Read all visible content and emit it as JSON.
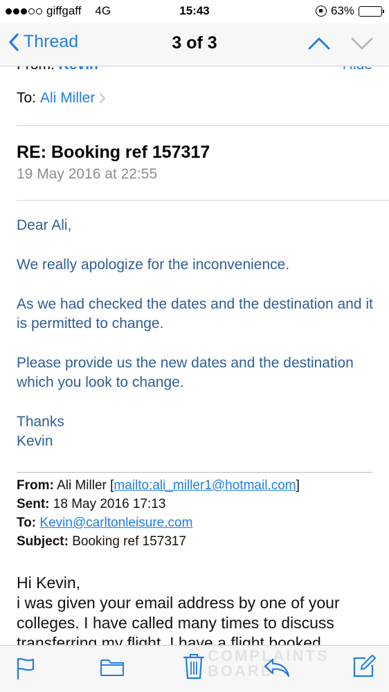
{
  "status_bar": {
    "carrier": "giffgaff",
    "network": "4G",
    "time": "15:43",
    "battery_percent": "63%",
    "battery_level": 0.63
  },
  "nav": {
    "back_label": "Thread",
    "title": "3 of 3"
  },
  "header": {
    "from_label": "From:",
    "from_name": "Kevin",
    "hide_label": "Hide",
    "to_label": "To:",
    "to_name": "Ali Miller",
    "subject": "RE: Booking ref 157317",
    "date": "19 May 2016 at 22:55"
  },
  "body": {
    "paragraphs": [
      "Dear Ali,",
      "We really apologize for the inconvenience.",
      "As we had checked the dates and the destination and it is permitted to change.",
      "Please provide us the new dates and the destination which you look to change.",
      "Thanks",
      "Kevin"
    ]
  },
  "quoted": {
    "from_label": "From:",
    "from_name": "Ali Miller",
    "from_link": "mailto:ali_miller1@hotmail.com",
    "sent_label": "Sent:",
    "sent_value": "18 May 2016 17:13",
    "to_label": "To:",
    "to_value": "Kevin@carltonleisure.com",
    "subject_label": "Subject:",
    "subject_value": "Booking ref 157317",
    "greeting": "Hi Kevin,",
    "text": "i was given your email address by one of your colleges. I have called many times to discuss transferring my flight. I have a flight booked"
  },
  "watermark": {
    "line1": "COMPLAINTS",
    "line2": "BOARD"
  },
  "colors": {
    "accent": "#1f7de3",
    "body_text": "#2e5e96",
    "meta_gray": "#8e8e93"
  },
  "toolbar": {
    "icons": [
      "flag-icon",
      "folder-icon",
      "trash-icon",
      "reply-icon",
      "compose-icon"
    ]
  }
}
